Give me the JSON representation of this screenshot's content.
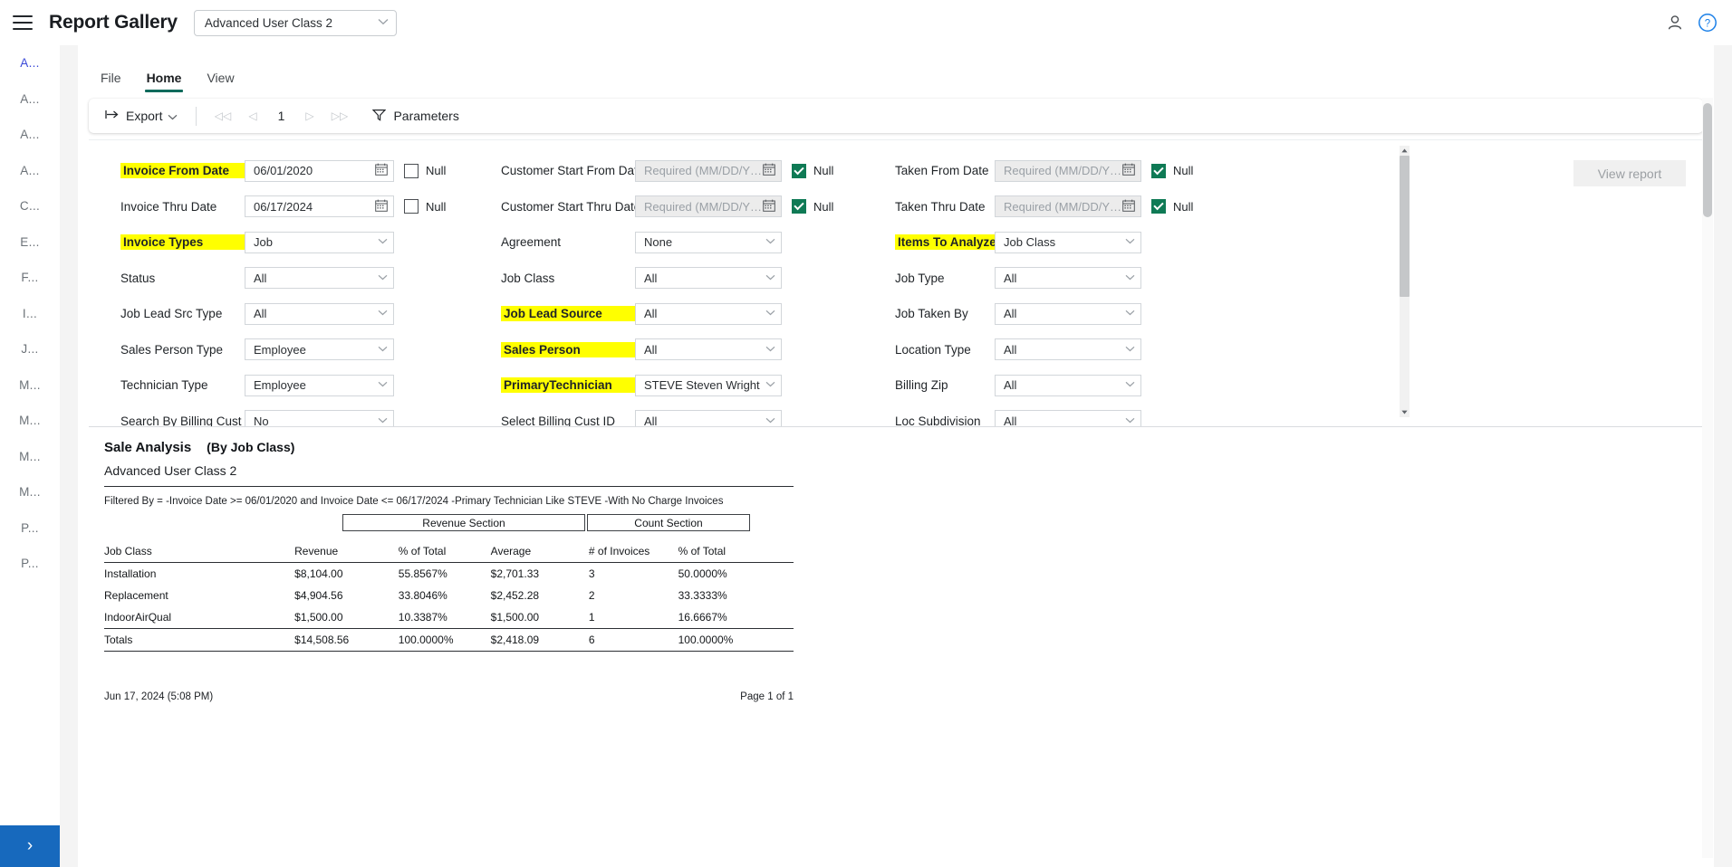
{
  "header": {
    "title": "Report Gallery",
    "menu_icon": "hamburger-icon",
    "class_selector_value": "Advanced User Class 2",
    "chevron": "⌄",
    "person_icon": "person-icon",
    "help_icon": "help-icon"
  },
  "sidebar": {
    "items": [
      {
        "label": "A...",
        "active": true
      },
      {
        "label": "A...",
        "active": false
      },
      {
        "label": "A...",
        "active": false
      },
      {
        "label": "A...",
        "active": false
      },
      {
        "label": "C...",
        "active": false
      },
      {
        "label": "E...",
        "active": false
      },
      {
        "label": "F...",
        "active": false
      },
      {
        "label": "I...",
        "active": false
      },
      {
        "label": "J...",
        "active": false
      },
      {
        "label": "M...",
        "active": false
      },
      {
        "label": "M...",
        "active": false
      },
      {
        "label": "M...",
        "active": false
      },
      {
        "label": "M...",
        "active": false
      },
      {
        "label": "P...",
        "active": false
      },
      {
        "label": "P...",
        "active": false
      }
    ],
    "expand_label": "›"
  },
  "ribbon": {
    "tabs": [
      {
        "label": "File",
        "active": false
      },
      {
        "label": "Home",
        "active": true
      },
      {
        "label": "View",
        "active": false
      }
    ]
  },
  "toolbar": {
    "export_label": "Export",
    "export_chevron": "⌄",
    "first_page": "◁◁",
    "prev_page": "◁",
    "page_number": "1",
    "next_page": "▷",
    "last_page": "▷▷",
    "parameters_label": "Parameters",
    "filter_icon": "filter-icon"
  },
  "view_report_button": "View report",
  "parameters": {
    "rows": [
      {
        "c1": {
          "label": "Invoice From Date",
          "highlight": true,
          "type": "date",
          "value": "06/01/2020",
          "null_label": "Null",
          "null_checked": false
        },
        "c2": {
          "label": "Customer Start From Date",
          "highlight": false,
          "type": "date",
          "value": "",
          "placeholder": "Required (MM/DD/YYYY)",
          "disabled": true,
          "null_label": "Null",
          "null_checked": true
        },
        "c3": {
          "label": "Taken From Date",
          "highlight": false,
          "type": "date",
          "value": "",
          "placeholder": "Required (MM/DD/YYYY)",
          "disabled": true,
          "null_label": "Null",
          "null_checked": true
        }
      },
      {
        "c1": {
          "label": "Invoice Thru Date",
          "highlight": false,
          "type": "date",
          "value": "06/17/2024",
          "null_label": "Null",
          "null_checked": false
        },
        "c2": {
          "label": "Customer Start Thru Date",
          "highlight": false,
          "type": "date",
          "value": "",
          "placeholder": "Required (MM/DD/YYYY)",
          "disabled": true,
          "null_label": "Null",
          "null_checked": true
        },
        "c3": {
          "label": "Taken Thru Date",
          "highlight": false,
          "type": "date",
          "value": "",
          "placeholder": "Required (MM/DD/YYYY)",
          "disabled": true,
          "null_label": "Null",
          "null_checked": true
        }
      },
      {
        "c1": {
          "label": "Invoice Types",
          "highlight": true,
          "type": "select",
          "value": "Job"
        },
        "c2": {
          "label": "Agreement",
          "highlight": false,
          "type": "select",
          "value": "None"
        },
        "c3": {
          "label": "Items To Analyze",
          "highlight": true,
          "type": "select",
          "value": "Job Class"
        }
      },
      {
        "c1": {
          "label": "Status",
          "highlight": false,
          "type": "select",
          "value": "All"
        },
        "c2": {
          "label": "Job Class",
          "highlight": false,
          "type": "select",
          "value": "All"
        },
        "c3": {
          "label": "Job Type",
          "highlight": false,
          "type": "select",
          "value": "All"
        }
      },
      {
        "c1": {
          "label": "Job Lead Src Type",
          "highlight": false,
          "type": "select",
          "value": "All"
        },
        "c2": {
          "label": "Job Lead Source",
          "highlight": true,
          "type": "select",
          "value": "All"
        },
        "c3": {
          "label": "Job Taken By",
          "highlight": false,
          "type": "select",
          "value": "All"
        }
      },
      {
        "c1": {
          "label": "Sales Person Type",
          "highlight": false,
          "type": "select",
          "value": "Employee"
        },
        "c2": {
          "label": "Sales Person",
          "highlight": true,
          "type": "select",
          "value": "All"
        },
        "c3": {
          "label": "Location Type",
          "highlight": false,
          "type": "select",
          "value": "All"
        }
      },
      {
        "c1": {
          "label": "Technician Type",
          "highlight": false,
          "type": "select",
          "value": "Employee"
        },
        "c2": {
          "label": "PrimaryTechnician",
          "highlight": true,
          "type": "select",
          "value": "STEVE Steven Wright"
        },
        "c3": {
          "label": "Billing Zip",
          "highlight": false,
          "type": "select",
          "value": "All"
        }
      },
      {
        "c1": {
          "label": "Search By Billing Cust ID",
          "highlight": false,
          "type": "select",
          "value": "No"
        },
        "c2": {
          "label": "Select Billing Cust ID",
          "highlight": false,
          "type": "select",
          "value": "All"
        },
        "c3": {
          "label": "Loc Subdivision",
          "highlight": false,
          "type": "select",
          "value": "All"
        }
      }
    ],
    "chevron": "⌄",
    "calendar_icon": "calendar-icon"
  },
  "report": {
    "title": "Sale Analysis",
    "subtitle": "(By Job Class)",
    "user_class": "Advanced User Class 2",
    "filtered_by": "Filtered By =   -Invoice Date >= 06/01/2020 and Invoice Date <= 06/17/2024 -Primary Technician Like STEVE  -With No Charge Invoices",
    "sections": {
      "revenue": "Revenue Section",
      "count": "Count Section"
    },
    "columns": [
      "Job Class",
      "Revenue",
      "% of Total",
      "Average",
      "# of Invoices",
      "% of Total"
    ],
    "rows": [
      [
        "Installation",
        "$8,104.00",
        "55.8567%",
        "$2,701.33",
        "3",
        "50.0000%"
      ],
      [
        "Replacement",
        "$4,904.56",
        "33.8046%",
        "$2,452.28",
        "2",
        "33.3333%"
      ],
      [
        "IndoorAirQual",
        "$1,500.00",
        "10.3387%",
        "$1,500.00",
        "1",
        "16.6667%"
      ]
    ],
    "totals": [
      "Totals",
      "$14,508.56",
      "100.0000%",
      "$2,418.09",
      "6",
      "100.0000%"
    ],
    "footer_date": "Jun 17, 2024 (5:08 PM)",
    "footer_page": "Page 1 of 1"
  },
  "colors": {
    "accent_tab": "#0f6b5c",
    "checkbox_checked": "#0f7a55",
    "highlight": "#ffff00",
    "sidebar_active": "#3a49d8",
    "expand_button": "#1769bd"
  }
}
